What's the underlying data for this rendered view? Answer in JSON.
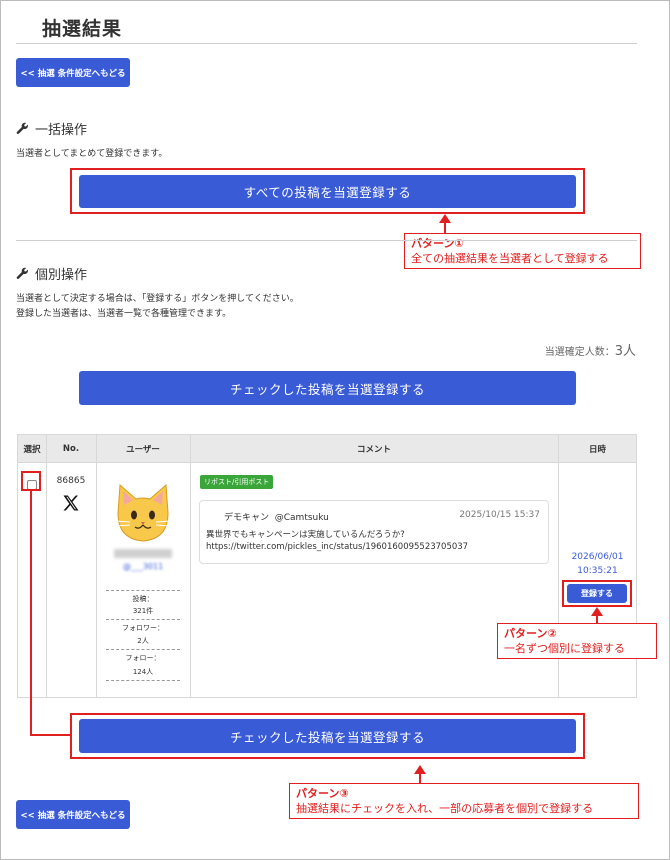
{
  "page": {
    "title": "抽選結果",
    "back_button_label": "<< 抽選 条件設定へもどる"
  },
  "bulk_section": {
    "title": "一括操作",
    "description": "当選者としてまとめて登録できます。",
    "button_label": "すべての投稿を当選登録する"
  },
  "individual_section": {
    "title": "個別操作",
    "description_line1": "当選者として決定する場合は、「登録する」ボタンを押してください。",
    "description_line2": "登録した当選者は、当選者一覧で各種管理できます。",
    "confirmed_label": "当選確定人数：",
    "confirmed_count": "3人",
    "checked_button_label": "チェックした投稿を当選登録する"
  },
  "table": {
    "headers": [
      "選択",
      "No.",
      "ユーザー",
      "コメント",
      "日時"
    ],
    "rows": [
      {
        "no": "86865",
        "username_blurred": "@___3011",
        "posts_label": "投稿：",
        "posts_value": "321件",
        "followers_label": "フォロワー：",
        "followers_value": "2人",
        "following_label": "フォロー：",
        "following_value": "124人",
        "badge": "リポスト/引用ポスト",
        "tweet_author": "デモキャン",
        "tweet_handle": "@Camtsuku",
        "tweet_datetime": "2025/10/15 15:37",
        "tweet_text": "異世界でもキャンペーンは実施しているんだろうか?",
        "tweet_url": "https://twitter.com/pickles_inc/status/1960160095523705037",
        "entry_date": "2026/06/01",
        "entry_time": "10:35:21",
        "register_button_label": "登録する"
      }
    ]
  },
  "annotations": {
    "pattern1_title": "パターン①",
    "pattern1_text": "全ての抽選結果を当選者として登録する",
    "pattern2_title": "パターン②",
    "pattern2_text": "一名ずつ個別に登録する",
    "pattern3_title": "パターン③",
    "pattern3_text": "抽選結果にチェックを入れ、一部の応募者を個別で登録する"
  },
  "colors": {
    "primary_button": "#3a5bd6",
    "annotation_red": "#e02020",
    "badge_green": "#3aa63a",
    "link_blue": "#3a5bd6"
  },
  "icons": {
    "section_icon": "wrench-icon",
    "platform_icon": "x-logo-icon",
    "avatar": "cat-face-icon"
  }
}
